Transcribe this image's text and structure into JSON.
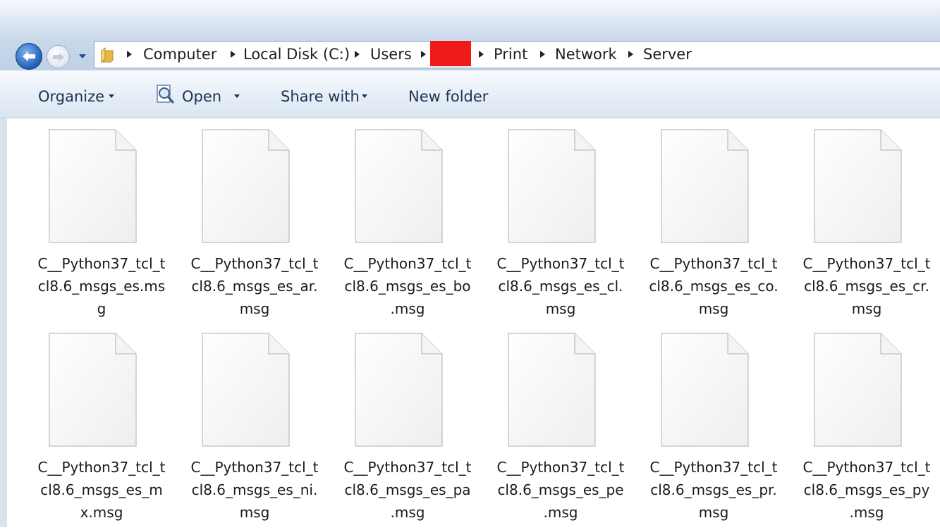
{
  "navigation": {
    "back_icon": "back-arrow-icon",
    "forward_icon": "forward-arrow-icon",
    "recent_icon": "chevron-down-icon"
  },
  "address": {
    "folder_icon": "folder-icon",
    "breadcrumbs": [
      "Computer",
      "Local Disk (C:)",
      "Users",
      "",
      "Print",
      "Network",
      "Server"
    ],
    "redaction_color": "#ef1a1a"
  },
  "toolbar": {
    "organize_label": "Organize",
    "open_label": "Open",
    "share_label": "Share with",
    "new_folder_label": "New folder"
  },
  "files": [
    {
      "line1": "C__Python37_tcl_t",
      "line2": "cl8.6_msgs_es.ms",
      "line3": "g"
    },
    {
      "line1": "C__Python37_tcl_t",
      "line2": "cl8.6_msgs_es_ar.",
      "line3": "msg"
    },
    {
      "line1": "C__Python37_tcl_t",
      "line2": "cl8.6_msgs_es_bo",
      "line3": ".msg"
    },
    {
      "line1": "C__Python37_tcl_t",
      "line2": "cl8.6_msgs_es_cl.",
      "line3": "msg"
    },
    {
      "line1": "C__Python37_tcl_t",
      "line2": "cl8.6_msgs_es_co.",
      "line3": "msg"
    },
    {
      "line1": "C__Python37_tcl_t",
      "line2": "cl8.6_msgs_es_cr.",
      "line3": "msg"
    },
    {
      "line1": "C__Python37_tcl_t",
      "line2": "cl8.6_msgs_es_m",
      "line3": "x.msg"
    },
    {
      "line1": "C__Python37_tcl_t",
      "line2": "cl8.6_msgs_es_ni.",
      "line3": "msg"
    },
    {
      "line1": "C__Python37_tcl_t",
      "line2": "cl8.6_msgs_es_pa",
      "line3": ".msg"
    },
    {
      "line1": "C__Python37_tcl_t",
      "line2": "cl8.6_msgs_es_pe",
      "line3": ".msg"
    },
    {
      "line1": "C__Python37_tcl_t",
      "line2": "cl8.6_msgs_es_pr.",
      "line3": "msg"
    },
    {
      "line1": "C__Python37_tcl_t",
      "line2": "cl8.6_msgs_es_py",
      "line3": ".msg"
    }
  ],
  "file_icon": "document-page-icon"
}
